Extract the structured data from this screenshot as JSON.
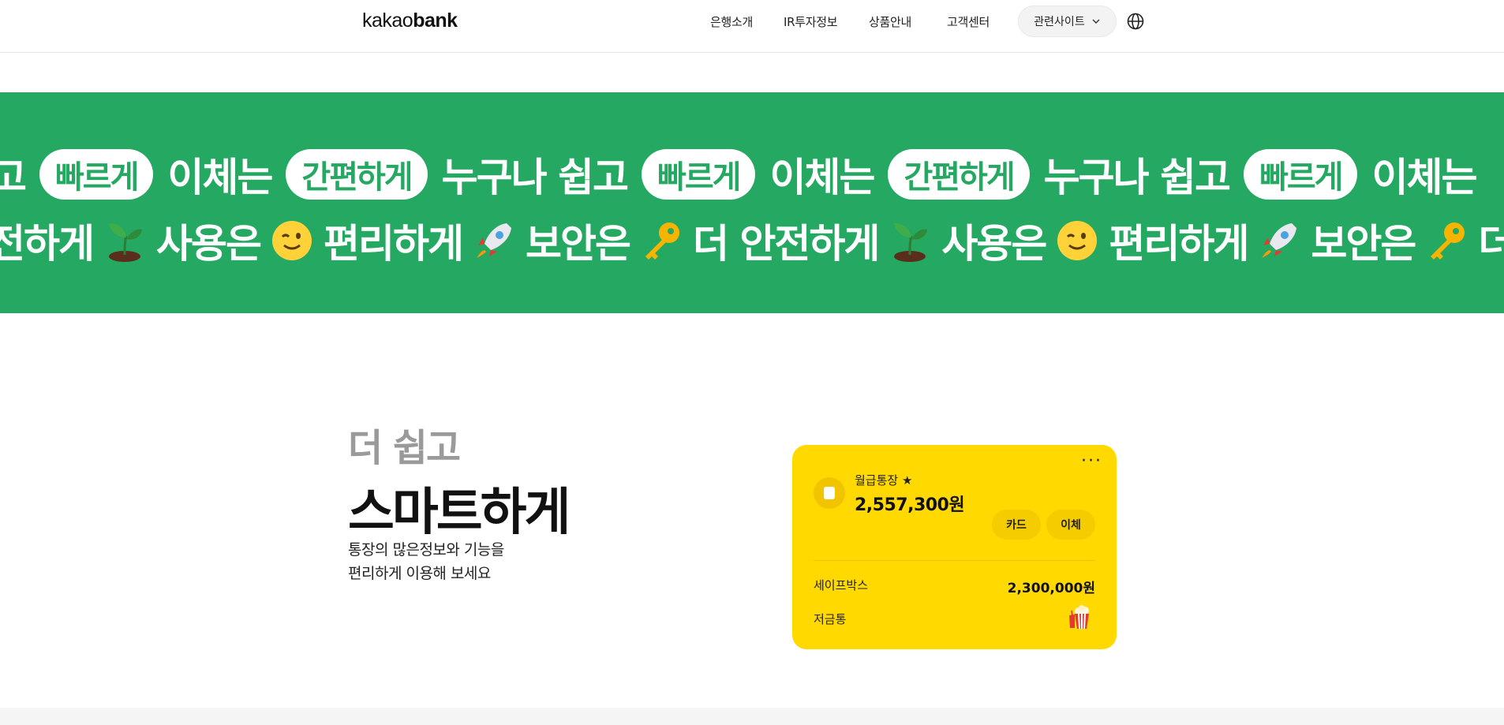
{
  "header": {
    "logo_part1": "kakao",
    "logo_part2": "bank",
    "nav": [
      "은행소개",
      "IR투자정보",
      "상품안내",
      "고객센터"
    ],
    "related_sites": "관련사이트"
  },
  "banner": {
    "row1": [
      {
        "t": "text",
        "v": "고"
      },
      {
        "t": "pill",
        "v": "빠르게"
      },
      {
        "t": "text",
        "v": "이체는"
      },
      {
        "t": "pill",
        "v": "간편하게"
      },
      {
        "t": "text",
        "v": "누구나 쉽고"
      },
      {
        "t": "pill",
        "v": "빠르게"
      },
      {
        "t": "text",
        "v": "이체는"
      },
      {
        "t": "pill",
        "v": "간편하게"
      },
      {
        "t": "text",
        "v": "누구나 쉽고"
      },
      {
        "t": "pill",
        "v": "빠르게"
      },
      {
        "t": "text",
        "v": "이체는"
      }
    ],
    "row2": [
      {
        "t": "text",
        "v": "전하게"
      },
      {
        "t": "emoji",
        "v": "sprout"
      },
      {
        "t": "text",
        "v": "사용은"
      },
      {
        "t": "emoji",
        "v": "wink"
      },
      {
        "t": "text",
        "v": "편리하게"
      },
      {
        "t": "emoji",
        "v": "rocket"
      },
      {
        "t": "text",
        "v": "보안은"
      },
      {
        "t": "emoji",
        "v": "key"
      },
      {
        "t": "text",
        "v": "더 안전하게"
      },
      {
        "t": "emoji",
        "v": "sprout"
      },
      {
        "t": "text",
        "v": "사용은"
      },
      {
        "t": "emoji",
        "v": "wink"
      },
      {
        "t": "text",
        "v": "편리하게"
      },
      {
        "t": "emoji",
        "v": "rocket"
      },
      {
        "t": "text",
        "v": "보안은"
      },
      {
        "t": "emoji",
        "v": "key"
      },
      {
        "t": "text",
        "v": "더"
      }
    ]
  },
  "feature": {
    "subtitle": "더 쉽고",
    "title": "스마트하게",
    "desc_line1": "통장의 많은정보와 기능을",
    "desc_line2": "편리하게 이용해 보세요"
  },
  "card": {
    "more": "···",
    "account_name": "월급통장 ★",
    "balance": "2,557,300원",
    "btn_card": "카드",
    "btn_transfer": "이체",
    "safebox_label": "세이프박스",
    "safebox_value": "2,300,000원",
    "piggy_label": "저금통"
  },
  "colors": {
    "banner_green": "#25a862",
    "card_yellow": "#ffd900"
  }
}
